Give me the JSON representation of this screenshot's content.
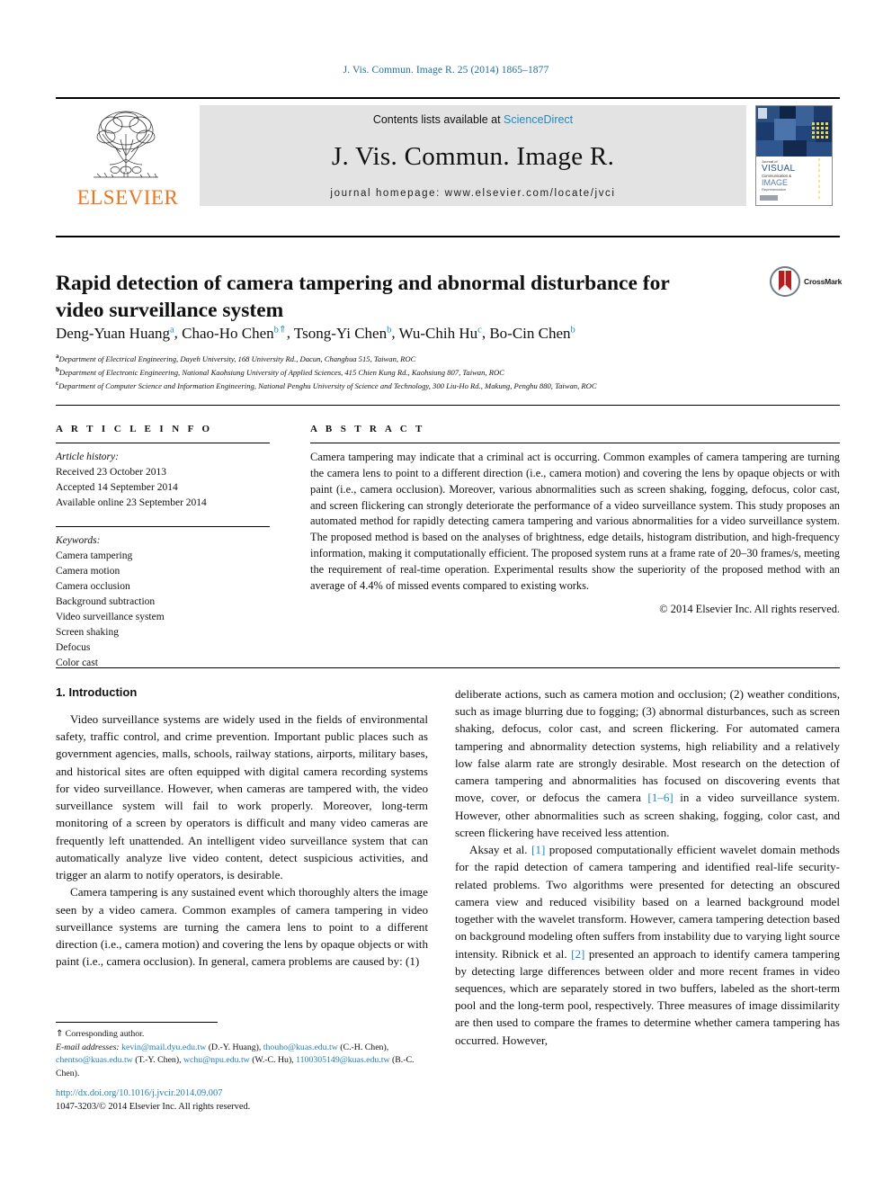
{
  "running_head": "J. Vis. Commun. Image R. 25 (2014) 1865–1877",
  "masthead": {
    "publisher": "ELSEVIER",
    "contents_prefix": "Contents lists available at ",
    "contents_link": "ScienceDirect",
    "journal_name": "J. Vis. Commun. Image R.",
    "homepage": "journal homepage: www.elsevier.com/locate/jvci",
    "cover": {
      "title_small": "Journal of",
      "line1": "VISUAL",
      "line2": "Communication &",
      "line3": "IMAGE",
      "line4": "Representation"
    }
  },
  "article": {
    "title": "Rapid detection of camera tampering and abnormal disturbance for video surveillance system",
    "crossmark_label": "CrossMark",
    "authors": [
      {
        "name": "Deng-Yuan Huang",
        "marks": "a",
        "corresponding": false
      },
      {
        "name": "Chao-Ho Chen",
        "marks": "b",
        "corresponding": true
      },
      {
        "name": "Tsong-Yi Chen",
        "marks": "b",
        "corresponding": false
      },
      {
        "name": "Wu-Chih Hu",
        "marks": "c",
        "corresponding": false
      },
      {
        "name": "Bo-Cin Chen",
        "marks": "b",
        "corresponding": false
      }
    ],
    "affiliations": [
      {
        "mark": "a",
        "text": "Department of Electrical Engineering, Dayeh University, 168 University Rd., Dacun, Changhua 515, Taiwan, ROC"
      },
      {
        "mark": "b",
        "text": "Department of Electronic Engineering, National Kaohsiung University of Applied Sciences, 415 Chien Kung Rd., Kaohsiung 807, Taiwan, ROC"
      },
      {
        "mark": "c",
        "text": "Department of Computer Science and Information Engineering, National Penghu University of Science and Technology, 300 Liu-Ho Rd., Makung, Penghu 880, Taiwan, ROC"
      }
    ]
  },
  "article_info": {
    "heading": "A R T I C L E    I N F O",
    "history_label": "Article history:",
    "history": [
      "Received 23 October 2013",
      "Accepted 14 September 2014",
      "Available online 23 September 2014"
    ],
    "keywords_label": "Keywords:",
    "keywords": [
      "Camera tampering",
      "Camera motion",
      "Camera occlusion",
      "Background subtraction",
      "Video surveillance system",
      "Screen shaking",
      "Defocus",
      "Color cast"
    ]
  },
  "abstract": {
    "heading": "A B S T R A C T",
    "text": "Camera tampering may indicate that a criminal act is occurring. Common examples of camera tampering are turning the camera lens to point to a different direction (i.e., camera motion) and covering the lens by opaque objects or with paint (i.e., camera occlusion). Moreover, various abnormalities such as screen shaking, fogging, defocus, color cast, and screen flickering can strongly deteriorate the performance of a video surveillance system. This study proposes an automated method for rapidly detecting camera tampering and various abnormalities for a video surveillance system. The proposed method is based on the analyses of brightness, edge details, histogram distribution, and high-frequency information, making it computationally efficient. The proposed system runs at a frame rate of 20–30 frames/s, meeting the requirement of real-time operation. Experimental results show the superiority of the proposed method with an average of 4.4% of missed events compared to existing works.",
    "copyright": "© 2014 Elsevier Inc. All rights reserved."
  },
  "body": {
    "section_heading": "1. Introduction",
    "left_paragraphs": [
      "Video surveillance systems are widely used in the fields of environmental safety, traffic control, and crime prevention. Important public places such as government agencies, malls, schools, railway stations, airports, military bases, and historical sites are often equipped with digital camera recording systems for video surveillance. However, when cameras are tampered with, the video surveillance system will fail to work properly. Moreover, long-term monitoring of a screen by operators is difficult and many video cameras are frequently left unattended. An intelligent video surveillance system that can automatically analyze live video content, detect suspicious activities, and trigger an alarm to notify operators, is desirable.",
      "Camera tampering is any sustained event which thoroughly alters the image seen by a video camera. Common examples of camera tampering in video surveillance systems are turning the camera lens to point to a different direction (i.e., camera motion) and covering the lens by opaque objects or with paint (i.e., camera occlusion). In general, camera problems are caused by: (1)"
    ],
    "right_paragraphs": [
      {
        "parts": [
          {
            "t": "deliberate actions, such as camera motion and occlusion; (2) weather conditions, such as image blurring due to fogging; (3) abnormal disturbances, such as screen shaking, defocus, color cast, and screen flickering. For automated camera tampering and abnormality detection systems, high reliability and a relatively low false alarm rate are strongly desirable. Most research on the detection of camera tampering and abnormalities has focused on discovering events that move, cover, or defocus the camera ",
            "ref": false
          },
          {
            "t": "[1–6]",
            "ref": true
          },
          {
            "t": " in a video surveillance system. However, other abnormalities such as screen shaking, fogging, color cast, and screen flickering have received less attention.",
            "ref": false
          }
        ],
        "indent": false
      },
      {
        "parts": [
          {
            "t": "Aksay et al. ",
            "ref": false
          },
          {
            "t": "[1]",
            "ref": true
          },
          {
            "t": " proposed computationally efficient wavelet domain methods for the rapid detection of camera tampering and identified real-life security-related problems. Two algorithms were presented for detecting an obscured camera view and reduced visibility based on a learned background model together with the wavelet transform. However, camera tampering detection based on background modeling often suffers from instability due to varying light source intensity. Ribnick et al. ",
            "ref": false
          },
          {
            "t": "[2]",
            "ref": true
          },
          {
            "t": " presented an approach to identify camera tampering by detecting large differences between older and more recent frames in video sequences, which are separately stored in two buffers, labeled as the short-term pool and the long-term pool, respectively. Three measures of image dissimilarity are then used to compare the frames to determine whether camera tampering has occurred. However,",
            "ref": false
          }
        ],
        "indent": true
      }
    ]
  },
  "footnote": {
    "corresponding_mark": "⇑",
    "corresponding_text": "Corresponding author.",
    "email_label": "E-mail addresses:",
    "emails": [
      {
        "address": "kevin@mail.dyu.edu.tw",
        "owner": "(D.-Y. Huang)"
      },
      {
        "address": "thouho@kuas.edu.tw",
        "owner": "(C.-H. Chen)"
      },
      {
        "address": "chentso@kuas.edu.tw",
        "owner": "(T.-Y. Chen)"
      },
      {
        "address": "wchu@npu.edu.tw",
        "owner": "(W.-C. Hu)"
      },
      {
        "address": "1100305149@kuas.edu.tw",
        "owner": "(B.-C. Chen)"
      }
    ]
  },
  "footer": {
    "doi": "http://dx.doi.org/10.1016/j.jvcir.2014.09.007",
    "issn_copyright": "1047-3203/© 2014 Elsevier Inc. All rights reserved."
  },
  "colors": {
    "link_blue": "#1f8ac0",
    "elsevier_orange": "#E87722",
    "band_gray": "#e3e3e3"
  }
}
